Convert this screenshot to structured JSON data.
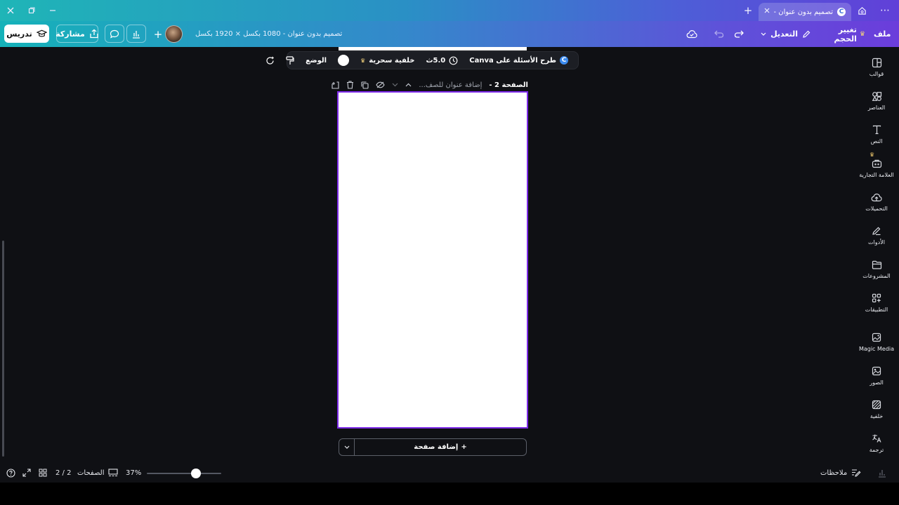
{
  "titlebar": {
    "tab_title": "تصميم بدون عنوان - 0...",
    "tab_badge": "C",
    "new_tab_symbol": "+",
    "more_symbol": "⋯"
  },
  "header": {
    "file_label": "ملف",
    "resize_label": "تغيير الحجم",
    "edit_label": "التعديل",
    "design_title": "تصميم بدون عنوان - 1080 بكسل × 1920 بكسل",
    "share_label": "مشاركة",
    "teach_label": "تدريس"
  },
  "context_toolbar": {
    "ask_canva_label": "طرح الأسئلة على Canva",
    "duration_label": "5.0ث",
    "magic_bg_label": "خلفية سحرية",
    "position_label": "الوضع",
    "color_value": "#ffffff"
  },
  "page": {
    "page_label": "الصفحة 2 -",
    "title_placeholder": "إضافة عنوان للصف...",
    "add_page_label": "إضافة صفحة",
    "add_symbol": "+"
  },
  "side_panel": {
    "items": [
      {
        "label": "قوالب",
        "icon": "templates-icon"
      },
      {
        "label": "العناصر",
        "icon": "elements-icon"
      },
      {
        "label": "النص",
        "icon": "text-icon"
      },
      {
        "label": "العلامة التجارية",
        "icon": "brand-icon"
      },
      {
        "label": "التحميلات",
        "icon": "uploads-icon"
      },
      {
        "label": "الأدوات",
        "icon": "tools-icon"
      },
      {
        "label": "المشروعات",
        "icon": "projects-icon"
      },
      {
        "label": "التطبيقات",
        "icon": "apps-icon"
      },
      {
        "label": "Magic Media",
        "icon": "magic-media-icon"
      },
      {
        "label": "الصور",
        "icon": "photos-icon"
      },
      {
        "label": "خلفية",
        "icon": "background-icon"
      },
      {
        "label": "ترجمة",
        "icon": "translate-icon"
      }
    ]
  },
  "bottom_bar": {
    "notes_label": "ملاحظات",
    "pages_label": "الصفحات",
    "page_count": "2 / 2",
    "zoom_label": "37%",
    "zoom_fraction": 0.66
  },
  "colors": {
    "accent": "#7d2ae8",
    "workspace": "#0f1014"
  }
}
